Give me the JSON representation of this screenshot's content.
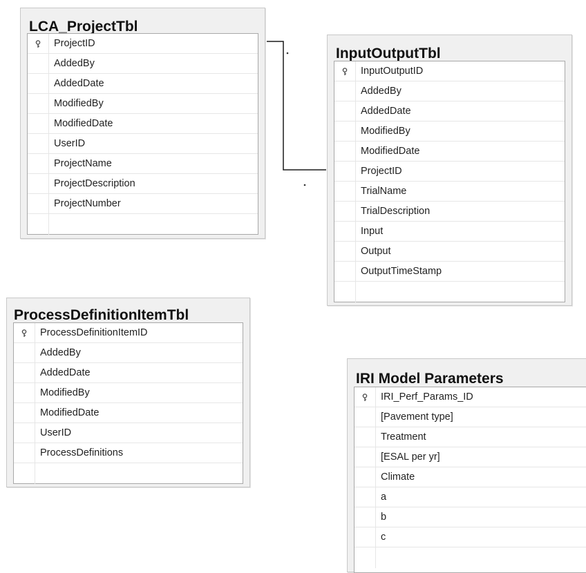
{
  "tables": {
    "lca_project": {
      "title": "LCA_ProjectTbl",
      "key_field": "ProjectID",
      "fields": [
        "AddedBy",
        "AddedDate",
        "ModifiedBy",
        "ModifiedDate",
        "UserID",
        "ProjectName",
        "ProjectDescription",
        "ProjectNumber"
      ]
    },
    "input_output": {
      "title": "InputOutputTbl",
      "key_field": "InputOutputID",
      "fields": [
        "AddedBy",
        "AddedDate",
        "ModifiedBy",
        "ModifiedDate",
        "ProjectID",
        "TrialName",
        "TrialDescription",
        "Input",
        "Output",
        "OutputTimeStamp"
      ]
    },
    "process_definition_item": {
      "title": "ProcessDefinitionItemTbl",
      "key_field": "ProcessDefinitionItemID",
      "fields": [
        "AddedBy",
        "AddedDate",
        "ModifiedBy",
        "ModifiedDate",
        "UserID",
        "ProcessDefinitions"
      ]
    },
    "iri_model_parameters": {
      "title": "IRI Model Parameters",
      "key_field": "IRI_Perf_Params_ID",
      "fields": [
        "[Pavement type]",
        "Treatment",
        "[ESAL per yr]",
        "Climate",
        "a",
        "b",
        "c"
      ]
    }
  },
  "relationships": [
    {
      "from": "LCA_ProjectTbl.ProjectID",
      "to": "InputOutputTbl.ProjectID",
      "from_end": "key-icon",
      "to_end": "infinity-icon"
    }
  ]
}
